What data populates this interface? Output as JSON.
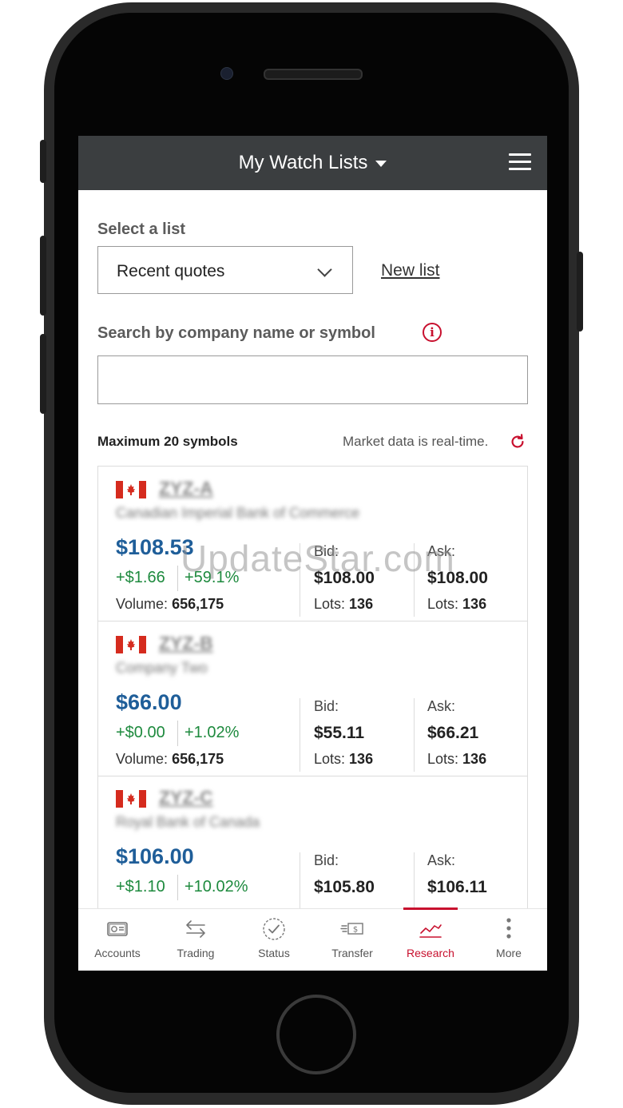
{
  "header": {
    "title": "My Watch Lists"
  },
  "list_select": {
    "label": "Select a list",
    "selected": "Recent quotes",
    "new_list": "New list"
  },
  "search": {
    "label": "Search by company name or symbol",
    "value": ""
  },
  "notes": {
    "max_symbols": "Maximum 20 symbols",
    "market_data": "Market data is real-time."
  },
  "quotes": [
    {
      "symbol": "ZYZ-A",
      "company": "Canadian Imperial Bank of Commerce",
      "price": "$108.53",
      "change": "+$1.66",
      "change_pct": "+59.1%",
      "volume_label": "Volume:",
      "volume": "656,175",
      "bid_label": "Bid:",
      "bid": "$108.00",
      "bid_lots_label": "Lots:",
      "bid_lots": "136",
      "ask_label": "Ask:",
      "ask": "$108.00",
      "ask_lots_label": "Lots:",
      "ask_lots": "136"
    },
    {
      "symbol": "ZYZ-B",
      "company": "Company Two",
      "price": "$66.00",
      "change": "+$0.00",
      "change_pct": "+1.02%",
      "volume_label": "Volume:",
      "volume": "656,175",
      "bid_label": "Bid:",
      "bid": "$55.11",
      "bid_lots_label": "Lots:",
      "bid_lots": "136",
      "ask_label": "Ask:",
      "ask": "$66.21",
      "ask_lots_label": "Lots:",
      "ask_lots": "136"
    },
    {
      "symbol": "ZYZ-C",
      "company": "Royal Bank of Canada",
      "price": "$106.00",
      "change": "+$1.10",
      "change_pct": "+10.02%",
      "bid_label": "Bid:",
      "bid": "$105.80",
      "ask_label": "Ask:",
      "ask": "$106.11"
    }
  ],
  "nav": [
    {
      "label": "Accounts",
      "icon": "accounts-icon"
    },
    {
      "label": "Trading",
      "icon": "trading-arrows-icon"
    },
    {
      "label": "Status",
      "icon": "status-check-icon"
    },
    {
      "label": "Transfer",
      "icon": "transfer-money-icon"
    },
    {
      "label": "Research",
      "icon": "research-chart-icon",
      "active": true
    },
    {
      "label": "More",
      "icon": "more-dots-icon"
    }
  ],
  "watermark": "UpdateStar.com",
  "colors": {
    "accent": "#c8102e",
    "price": "#1f5e99",
    "gain": "#1e8a3e",
    "header_bg": "#3b3e40"
  }
}
